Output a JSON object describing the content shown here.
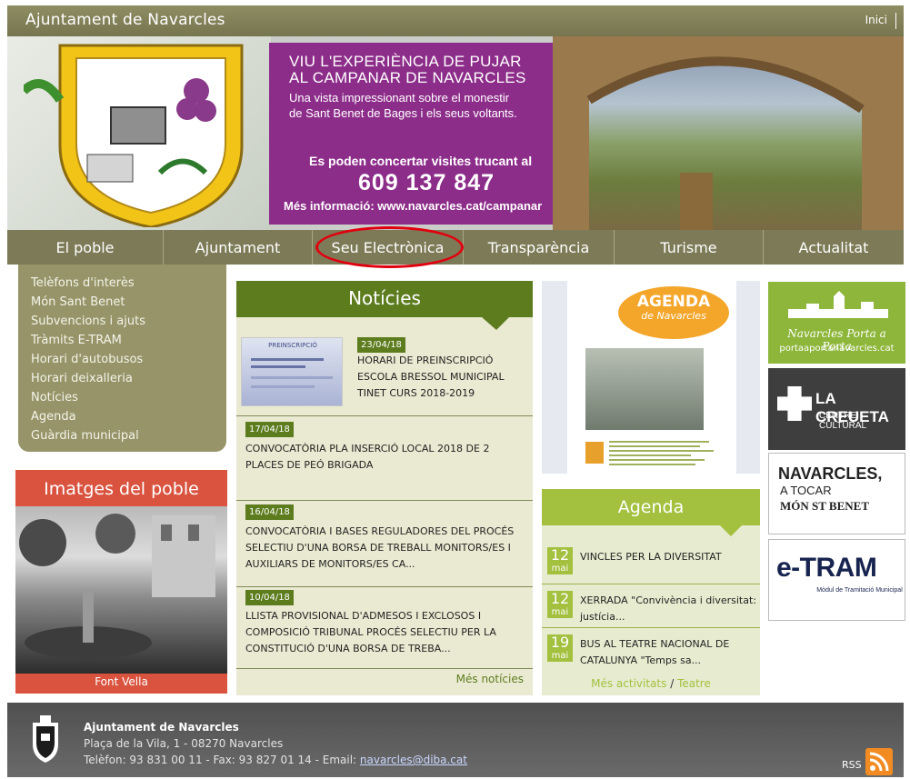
{
  "header": {
    "site_title": "Ajuntament de Navarcles",
    "inici": "Inici"
  },
  "banner": {
    "title_line1": "VIU L'EXPERIÈNCIA DE PUJAR",
    "title_line2": "AL CAMPANAR DE NAVARCLES",
    "sub_line1": "Una vista impressionant sobre el monestir",
    "sub_line2": "de Sant Benet de Bages i els seus voltants.",
    "contact": "Es poden concertar visites trucant al",
    "phone": "609 137 847",
    "info": "Més informació: www.navarcles.cat/campanar"
  },
  "nav": {
    "items": [
      "El poble",
      "Ajuntament",
      "Seu Electrònica",
      "Transparència",
      "Turisme",
      "Actualitat"
    ],
    "highlighted": "Seu Electrònica",
    "highlight_color": "#e1000f"
  },
  "sidebar": {
    "items": [
      "Telèfons d'interès",
      "Món Sant Benet",
      "Subvencions i ajuts",
      "Tràmits E-TRAM",
      "Horari d'autobusos",
      "Horari deixalleria",
      "Notícies",
      "Agenda",
      "Guàrdia municipal"
    ]
  },
  "imatges": {
    "title": "Imatges del poble",
    "caption": "Font Vella"
  },
  "noticies": {
    "title": "Notícies",
    "items": [
      {
        "date": "23/04/18",
        "title": "HORARI DE PREINSCRIPCIÓ ESCOLA BRESSOL MUNICIPAL TINET CURS 2018-2019"
      },
      {
        "date": "17/04/18",
        "title": "CONVOCATÒRIA PLA INSERCIÓ LOCAL 2018 DE 2 PLACES DE PEÓ BRIGADA"
      },
      {
        "date": "16/04/18",
        "title": "CONVOCATÒRIA I BASES REGULADORES DEL PROCÉS SELECTIU D'UNA BORSA DE TREBALL MONITORS/ES I AUXILIARS DE MONITORS/ES CA..."
      },
      {
        "date": "10/04/18",
        "title": "LLISTA PROVISIONAL D'ADMESOS I EXCLOSOS I COMPOSICIÓ TRIBUNAL PROCÉS SELECTIU PER LA CONSTITUCIÓ D'UNA BORSA DE TREBA..."
      }
    ],
    "more": "Més notícies",
    "thumb_text": "PREINSCRIPCIÓ"
  },
  "agenda_poster": {
    "title_line1": "AGENDA",
    "title_line2": "de Navarcles"
  },
  "agenda": {
    "title": "Agenda",
    "events": [
      {
        "day": "12",
        "month": "mai",
        "title": "VINCLES PER LA DIVERSITAT"
      },
      {
        "day": "12",
        "month": "mai",
        "title": "XERRADA \"Convivència i diversitat: justícia..."
      },
      {
        "day": "19",
        "month": "mai",
        "title": "BUS AL TEATRE NACIONAL DE CATALUNYA \"Temps sa..."
      }
    ],
    "more_activities": "Més activitats",
    "separator": "/",
    "theatre": "Teatre"
  },
  "ads": {
    "porta_title": "Navarcles Porta a Porta",
    "porta_url": "portaaportanavarcles.cat",
    "creueta_title": "LA CREUETA",
    "creueta_sub": "CENTRE CULTURAL",
    "tocar_line1": "NAVARCLES,",
    "tocar_line2": "A TOCAR",
    "tocar_line3": "MÓN ST BENET",
    "etram_title": "e-TRAM",
    "etram_sub": "Mòdul de Tramitació Municipal"
  },
  "footer": {
    "name": "Ajuntament de Navarcles",
    "address": "Plaça de la Vila, 1 - 08270 Navarcles",
    "contact_prefix": "Telèfon: 93 831 00 11 - Fax: 93 827 01 14 - Email: ",
    "email": "navarcles@diba.cat",
    "rss": "RSS"
  }
}
